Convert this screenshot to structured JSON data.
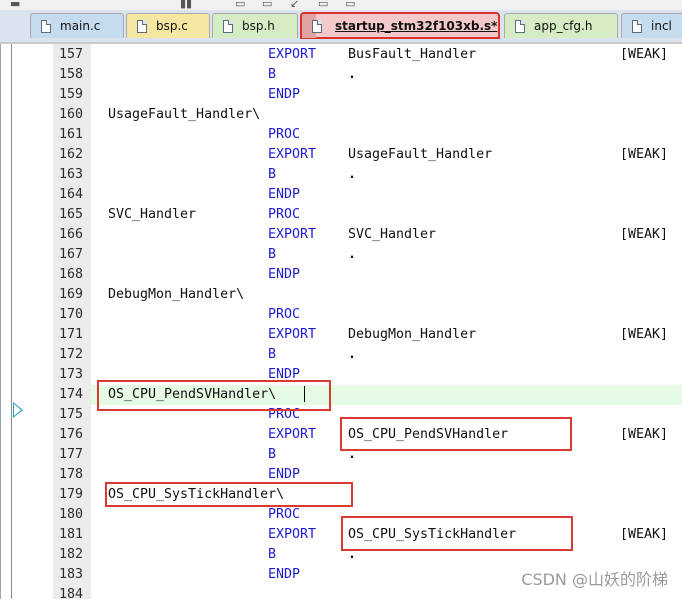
{
  "tabs": [
    {
      "label": "main.c",
      "color": "#c5dbee",
      "active": false
    },
    {
      "label": "bsp.c",
      "color": "#f5e7a0",
      "active": false
    },
    {
      "label": "bsp.h",
      "color": "#d6ecc4",
      "active": false
    },
    {
      "label": "startup_stm32f103xb.s*",
      "color": "#f4c9c9",
      "active": true
    },
    {
      "label": "app_cfg.h",
      "color": "#d6ecc4",
      "active": false
    },
    {
      "label": "incl",
      "color": "#c5dbee",
      "active": false
    }
  ],
  "editor": {
    "current_line": "174",
    "keyword_color": "#1c1ccf",
    "highlight_color": "#e5fbe4",
    "lines": [
      {
        "num": "157",
        "label": "",
        "op": "EXPORT",
        "arg": "BusFault_Handler",
        "attr": "[WEAK]"
      },
      {
        "num": "158",
        "label": "",
        "op": "B",
        "arg": ".",
        "attr": ""
      },
      {
        "num": "159",
        "label": "",
        "op": "ENDP",
        "arg": "",
        "attr": ""
      },
      {
        "num": "160",
        "label": "UsageFault_Handler\\",
        "op": "",
        "arg": "",
        "attr": ""
      },
      {
        "num": "161",
        "label": "",
        "op": "PROC",
        "arg": "",
        "attr": ""
      },
      {
        "num": "162",
        "label": "",
        "op": "EXPORT",
        "arg": "UsageFault_Handler",
        "attr": "[WEAK]"
      },
      {
        "num": "163",
        "label": "",
        "op": "B",
        "arg": ".",
        "attr": ""
      },
      {
        "num": "164",
        "label": "",
        "op": "ENDP",
        "arg": "",
        "attr": ""
      },
      {
        "num": "165",
        "label": "SVC_Handler",
        "op": "PROC",
        "arg": "",
        "attr": ""
      },
      {
        "num": "166",
        "label": "",
        "op": "EXPORT",
        "arg": "SVC_Handler",
        "attr": "[WEAK]"
      },
      {
        "num": "167",
        "label": "",
        "op": "B",
        "arg": ".",
        "attr": ""
      },
      {
        "num": "168",
        "label": "",
        "op": "ENDP",
        "arg": "",
        "attr": ""
      },
      {
        "num": "169",
        "label": "DebugMon_Handler\\",
        "op": "",
        "arg": "",
        "attr": ""
      },
      {
        "num": "170",
        "label": "",
        "op": "PROC",
        "arg": "",
        "attr": ""
      },
      {
        "num": "171",
        "label": "",
        "op": "EXPORT",
        "arg": "DebugMon_Handler",
        "attr": "[WEAK]"
      },
      {
        "num": "172",
        "label": "",
        "op": "B",
        "arg": ".",
        "attr": ""
      },
      {
        "num": "173",
        "label": "",
        "op": "ENDP",
        "arg": "",
        "attr": ""
      },
      {
        "num": "174",
        "label": "OS_CPU_PendSVHandler\\",
        "op": "",
        "arg": "",
        "attr": ""
      },
      {
        "num": "175",
        "label": "",
        "op": "PROC",
        "arg": "",
        "attr": ""
      },
      {
        "num": "176",
        "label": "",
        "op": "EXPORT",
        "arg": "OS_CPU_PendSVHandler",
        "attr": "[WEAK]"
      },
      {
        "num": "177",
        "label": "",
        "op": "B",
        "arg": ".",
        "attr": ""
      },
      {
        "num": "178",
        "label": "",
        "op": "ENDP",
        "arg": "",
        "attr": ""
      },
      {
        "num": "179",
        "label": "OS_CPU_SysTickHandler\\",
        "op": "",
        "arg": "",
        "attr": ""
      },
      {
        "num": "180",
        "label": "",
        "op": "PROC",
        "arg": "",
        "attr": ""
      },
      {
        "num": "181",
        "label": "",
        "op": "EXPORT",
        "arg": "OS_CPU_SysTickHandler",
        "attr": "[WEAK]"
      },
      {
        "num": "182",
        "label": "",
        "op": "B",
        "arg": ".",
        "attr": ""
      },
      {
        "num": "183",
        "label": "",
        "op": "ENDP",
        "arg": "",
        "attr": ""
      },
      {
        "num": "184",
        "label": "",
        "op": "",
        "arg": "",
        "attr": ""
      }
    ]
  },
  "watermark": "CSDN @山妖的阶梯"
}
